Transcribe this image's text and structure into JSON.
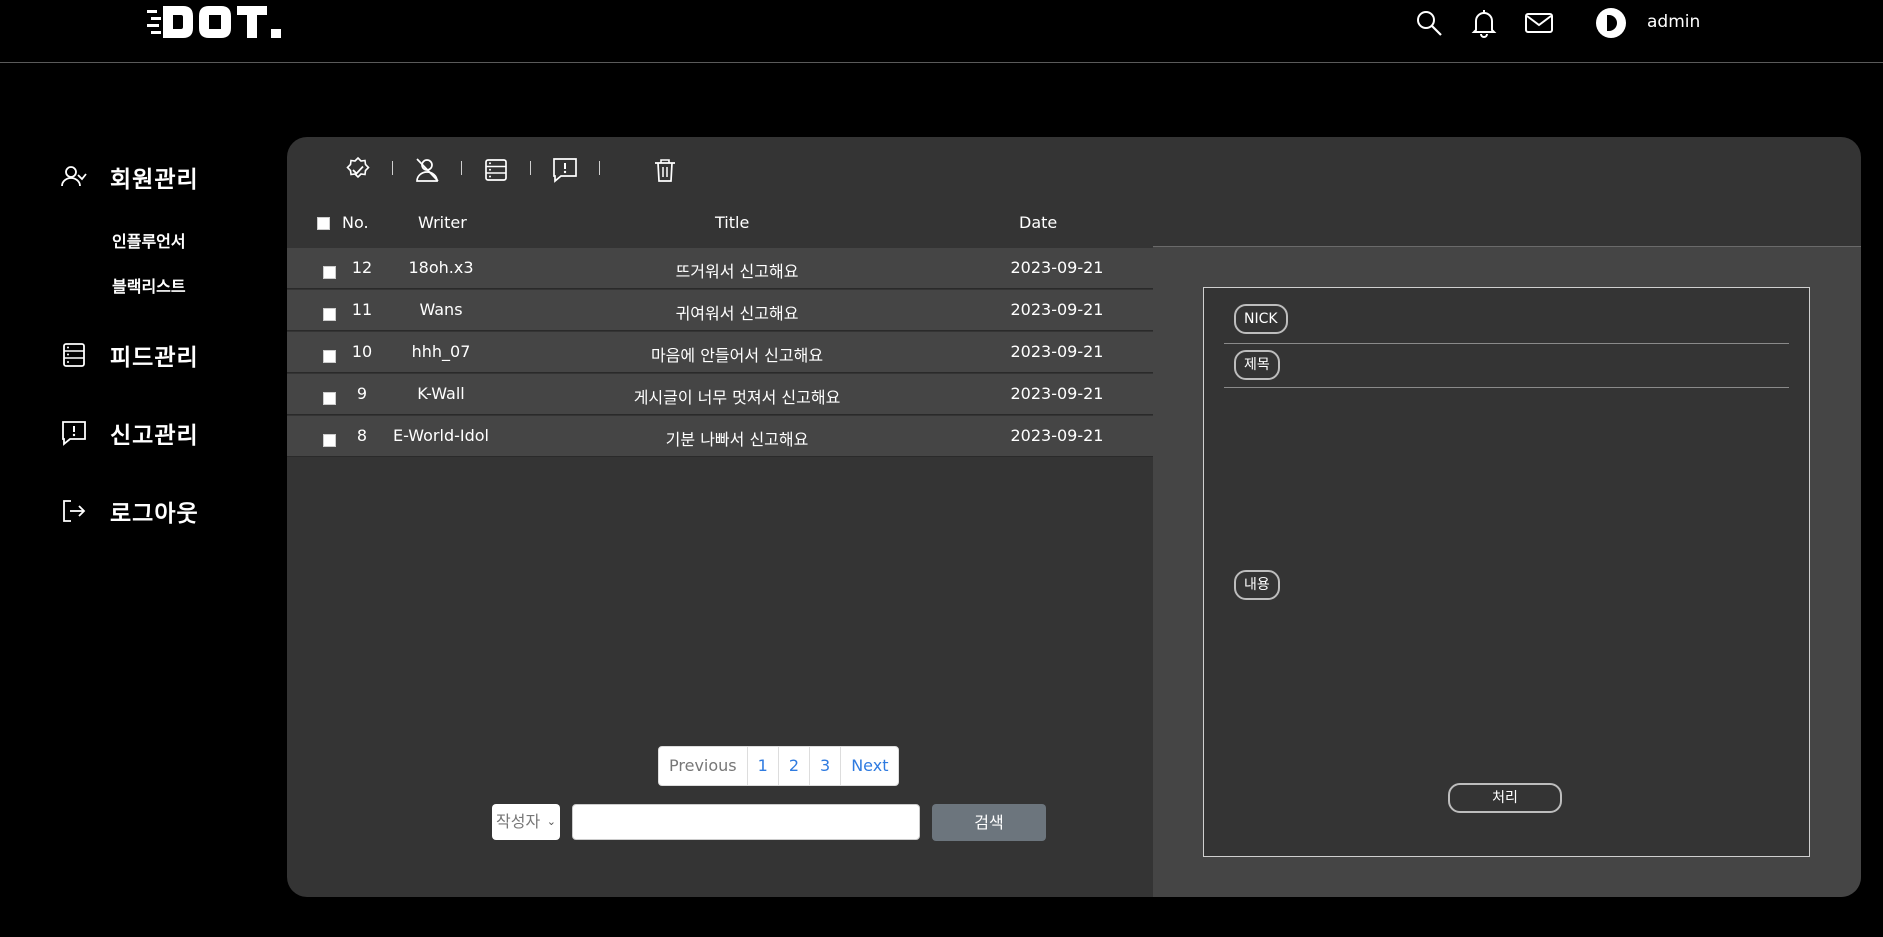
{
  "header": {
    "logo_text": "DOT.",
    "user_name": "admin",
    "icons": [
      "search-icon",
      "bell-icon",
      "mail-icon"
    ]
  },
  "sidebar": {
    "items": [
      {
        "label": "회원관리",
        "icon": "user-icon"
      },
      {
        "label": "피드관리",
        "icon": "feed-list-icon"
      },
      {
        "label": "신고관리",
        "icon": "report-icon"
      },
      {
        "label": "로그아웃",
        "icon": "logout-icon"
      }
    ],
    "sub_items": [
      "인플루언서",
      "블랙리스트"
    ]
  },
  "toolbar": {
    "icons": [
      "verified-badge-icon",
      "user-block-icon",
      "feed-list-icon",
      "report-icon",
      "trash-icon"
    ],
    "separator": "|"
  },
  "table": {
    "headers": {
      "no": "No.",
      "writer": "Writer",
      "title": "Title",
      "date": "Date"
    },
    "rows": [
      {
        "no": "12",
        "writer": "18oh.x3",
        "title": "뜨거워서 신고해요",
        "date": "2023-09-21"
      },
      {
        "no": "11",
        "writer": "Wans",
        "title": "귀여워서 신고해요",
        "date": "2023-09-21"
      },
      {
        "no": "10",
        "writer": "hhh_07",
        "title": "마음에 안들어서 신고해요",
        "date": "2023-09-21"
      },
      {
        "no": "9",
        "writer": "K-Wall",
        "title": "게시글이 너무 멋져서 신고해요",
        "date": "2023-09-21"
      },
      {
        "no": "8",
        "writer": "E-World-Idol",
        "title": "기분 나빠서 신고해요",
        "date": "2023-09-21"
      }
    ]
  },
  "detail": {
    "nick_label": "NICK",
    "title_label": "제목",
    "content_label": "내용",
    "process_button": "처리"
  },
  "pagination": {
    "previous": "Previous",
    "pages": [
      "1",
      "2",
      "3"
    ],
    "next": "Next"
  },
  "search": {
    "select_value": "작성자",
    "input_value": "",
    "button_label": "검색"
  },
  "colors": {
    "background": "#000000",
    "panel": "#343434",
    "row": "#454545",
    "link": "#2f7be0",
    "search_button": "#6c757d"
  }
}
